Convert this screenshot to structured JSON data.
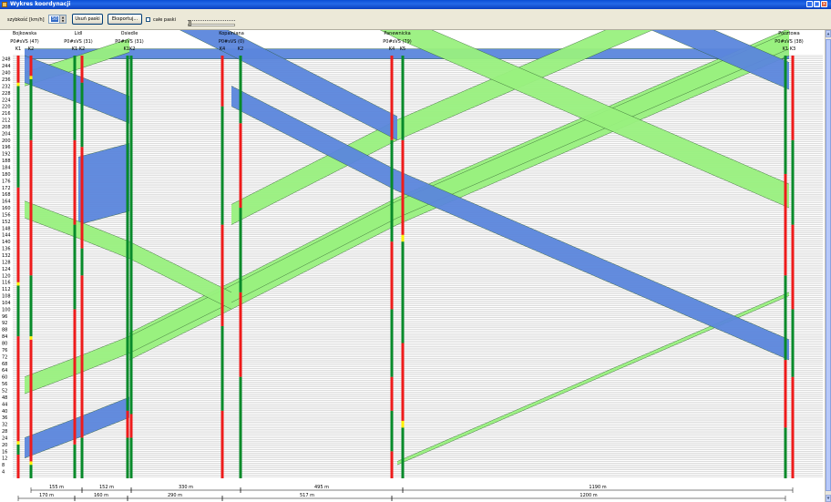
{
  "window": {
    "title": "Wykres koordynacji",
    "icon": "app-icon",
    "controls": [
      "minimize-icon",
      "maximize-icon",
      "close-icon"
    ]
  },
  "toolbar": {
    "speed_label": "szybkość [km/h]",
    "speed_value": "50",
    "remove_bands_label": "Usuń paski",
    "export_label": "Eksportuj...",
    "whole_bands_label": "całe paski",
    "whole_bands_checked": false
  },
  "colors": {
    "band_green": "#99f07e",
    "band_blue": "#5b86dc",
    "signal_green": "#078a2a",
    "signal_red": "#ee1b1b",
    "signal_yellow": "#fff200",
    "background": "#ffffff",
    "gridline": "#9c9c9c"
  },
  "chart_data": {
    "type": "time-space diagram",
    "y_ticks": [
      4,
      8,
      12,
      16,
      20,
      24,
      28,
      32,
      36,
      40,
      44,
      48,
      52,
      56,
      60,
      64,
      68,
      72,
      76,
      80,
      84,
      88,
      92,
      96,
      100,
      104,
      108,
      112,
      116,
      120,
      124,
      128,
      132,
      136,
      140,
      144,
      148,
      152,
      156,
      160,
      164,
      168,
      172,
      176,
      180,
      184,
      188,
      192,
      196,
      200,
      204,
      208,
      212,
      216,
      220,
      224,
      228,
      232,
      236,
      240,
      244,
      248
    ],
    "ylim": [
      0,
      250
    ],
    "intersections": [
      {
        "name": "Bojkowska",
        "program": "P0#sVS (47)",
        "signals": [
          "K1",
          "K2"
        ]
      },
      {
        "name": "Lidl",
        "program": "P0#sVS (31)",
        "signals": [
          "K1",
          "K2"
        ]
      },
      {
        "name": "Osiedle",
        "program": "P0#sVS (31)",
        "signals": [
          "K1K2"
        ]
      },
      {
        "name": "Kopalniana",
        "program": "P0#sVS (0)",
        "signals": [
          "K4",
          "K2"
        ]
      },
      {
        "name": "Panewnicka",
        "program": "P0#sVS (79)",
        "signals": [
          "K4",
          "K5"
        ]
      },
      {
        "name": "Pocztowa",
        "program": "P0#sVS (38)",
        "signals": [
          "K1",
          "K3"
        ]
      }
    ],
    "distances_top": [
      "155 m",
      "152 m",
      "330 m",
      "495 m",
      "1190 m"
    ],
    "distances_bottom": [
      "170 m",
      "160 m",
      "290 m",
      "517 m",
      "1200 m"
    ],
    "signal_timing": [
      [
        [
          [
            "r",
            0,
            14
          ],
          [
            "g",
            14,
            20
          ],
          [
            "y",
            20,
            22
          ],
          [
            "r",
            22,
            84
          ],
          [
            "g",
            84,
            114
          ],
          [
            "y",
            114,
            116
          ],
          [
            "r",
            116,
            172
          ],
          [
            "g",
            172,
            232
          ],
          [
            "y",
            232,
            234
          ],
          [
            "r",
            234,
            250
          ]
        ],
        [
          [
            "g",
            0,
            8
          ],
          [
            "y",
            8,
            10
          ],
          [
            "r",
            10,
            82
          ],
          [
            "y",
            82,
            84
          ],
          [
            "g",
            84,
            120
          ],
          [
            "r",
            120,
            200
          ],
          [
            "g",
            200,
            236
          ],
          [
            "y",
            236,
            238
          ],
          [
            "r",
            238,
            250
          ]
        ]
      ],
      [
        [
          [
            "g",
            0,
            20
          ],
          [
            "r",
            20,
            100
          ],
          [
            "g",
            100,
            150
          ],
          [
            "r",
            150,
            200
          ],
          [
            "g",
            200,
            250
          ]
        ],
        [
          [
            "g",
            0,
            24
          ],
          [
            "r",
            24,
            120
          ],
          [
            "g",
            120,
            136
          ],
          [
            "r",
            136,
            196
          ],
          [
            "g",
            196,
            234
          ],
          [
            "r",
            234,
            250
          ]
        ]
      ],
      [
        [
          [
            "g",
            0,
            24
          ],
          [
            "r",
            24,
            40
          ],
          [
            "g",
            40,
            250
          ]
        ],
        [
          [
            "g",
            0,
            24
          ],
          [
            "r",
            24,
            38
          ],
          [
            "g",
            38,
            250
          ]
        ]
      ],
      [
        [
          [
            "r",
            0,
            40
          ],
          [
            "g",
            40,
            90
          ],
          [
            "r",
            90,
            150
          ],
          [
            "g",
            150,
            220
          ],
          [
            "r",
            220,
            250
          ]
        ],
        [
          [
            "g",
            0,
            60
          ],
          [
            "r",
            60,
            110
          ],
          [
            "g",
            110,
            160
          ],
          [
            "r",
            160,
            210
          ],
          [
            "g",
            210,
            250
          ]
        ]
      ],
      [
        [
          [
            "r",
            0,
            16
          ],
          [
            "g",
            16,
            40
          ],
          [
            "r",
            40,
            60
          ],
          [
            "g",
            60,
            100
          ],
          [
            "r",
            100,
            140
          ],
          [
            "g",
            140,
            200
          ],
          [
            "r",
            200,
            250
          ]
        ],
        [
          [
            "g",
            0,
            30
          ],
          [
            "y",
            30,
            34
          ],
          [
            "r",
            34,
            80
          ],
          [
            "g",
            80,
            140
          ],
          [
            "y",
            140,
            144
          ],
          [
            "r",
            144,
            200
          ],
          [
            "g",
            200,
            250
          ]
        ]
      ],
      [
        [
          [
            "g",
            0,
            30
          ],
          [
            "r",
            30,
            70
          ],
          [
            "g",
            70,
            120
          ],
          [
            "r",
            120,
            180
          ],
          [
            "g",
            180,
            250
          ]
        ],
        [
          [
            "r",
            0,
            60
          ],
          [
            "g",
            60,
            100
          ],
          [
            "r",
            100,
            150
          ],
          [
            "g",
            150,
            200
          ],
          [
            "r",
            200,
            250
          ]
        ]
      ]
    ],
    "bands": [
      {
        "color": "blue",
        "dir": "up",
        "from": 0,
        "to": 5,
        "t": 248,
        "w": 6,
        "dt": [
          0,
          0,
          0,
          0,
          0
        ]
      },
      {
        "color": "green",
        "dir": "up",
        "from": 0,
        "to": 2,
        "t": 232,
        "w": 8,
        "dt": [
          10,
          10,
          0,
          0,
          0
        ]
      },
      {
        "color": "blue",
        "dir": "up",
        "from": 1,
        "to": 2,
        "t": 150,
        "w": 40,
        "dt": [
          0,
          8,
          0,
          0,
          0
        ]
      },
      {
        "color": "green",
        "dir": "up",
        "from": 2,
        "to": 5,
        "t": 70,
        "w": 16,
        "dt": [
          0,
          0,
          30,
          50,
          100
        ]
      },
      {
        "color": "green",
        "dir": "up",
        "from": 0,
        "to": 5,
        "t": 50,
        "w": 10,
        "dt": [
          12,
          12,
          30,
          50,
          100
        ]
      },
      {
        "color": "blue",
        "dir": "up",
        "from": 0,
        "to": 2,
        "t": 12,
        "w": 12,
        "dt": [
          12,
          12,
          0,
          0,
          0
        ]
      },
      {
        "color": "green",
        "dir": "up",
        "from": 3,
        "to": 5,
        "t": 150,
        "w": 12,
        "dt": [
          0,
          0,
          0,
          50,
          100
        ]
      },
      {
        "color": "green",
        "dir": "up",
        "from": 4,
        "to": 5,
        "t": 8,
        "w": 2,
        "dt": [
          0,
          0,
          0,
          0,
          100
        ]
      },
      {
        "color": "blue",
        "dir": "down",
        "from": 5,
        "to": 0,
        "t": 230,
        "w": 16,
        "dt": [
          12,
          12,
          30,
          50,
          100
        ]
      },
      {
        "color": "green",
        "dir": "down",
        "from": 5,
        "to": 3,
        "t": 160,
        "w": 14,
        "dt": [
          0,
          0,
          0,
          50,
          100
        ]
      },
      {
        "color": "blue",
        "dir": "down",
        "from": 4,
        "to": 0,
        "t": 200,
        "w": 14,
        "dt": [
          12,
          12,
          30,
          50,
          0
        ]
      },
      {
        "color": "green",
        "dir": "down",
        "from": 3,
        "to": 0,
        "t": 100,
        "w": 10,
        "dt": [
          12,
          12,
          30,
          0,
          0
        ]
      },
      {
        "color": "blue",
        "dir": "down",
        "from": 5,
        "to": 3,
        "t": 70,
        "w": 12,
        "dt": [
          0,
          0,
          0,
          50,
          100
        ]
      },
      {
        "color": "blue",
        "dir": "down",
        "from": 2,
        "to": 0,
        "t": 210,
        "w": 16,
        "dt": [
          12,
          12,
          0,
          0,
          0
        ]
      }
    ]
  }
}
